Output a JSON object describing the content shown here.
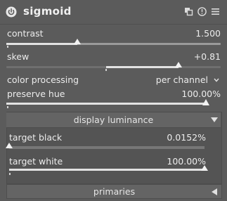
{
  "module": {
    "title": "sigmoid",
    "icons": [
      "power-icon",
      "multi-instance-icon",
      "reset-icon",
      "presets-icon"
    ]
  },
  "contrast": {
    "label": "contrast",
    "value": "1.500",
    "level": 0.33
  },
  "skew": {
    "label": "skew",
    "value": "+0.81",
    "level": 0.81
  },
  "color_processing": {
    "label": "color processing",
    "value": "per channel"
  },
  "preserve_hue": {
    "label": "preserve hue",
    "value": "100.00%",
    "level": 1.0
  },
  "display_luminance": {
    "header": "display luminance",
    "target_black": {
      "label": "target black",
      "value": "0.0152%",
      "level": 0.0
    },
    "target_white": {
      "label": "target white",
      "value": "100.00%",
      "level": 1.0
    }
  },
  "primaries": {
    "header": "primaries"
  }
}
